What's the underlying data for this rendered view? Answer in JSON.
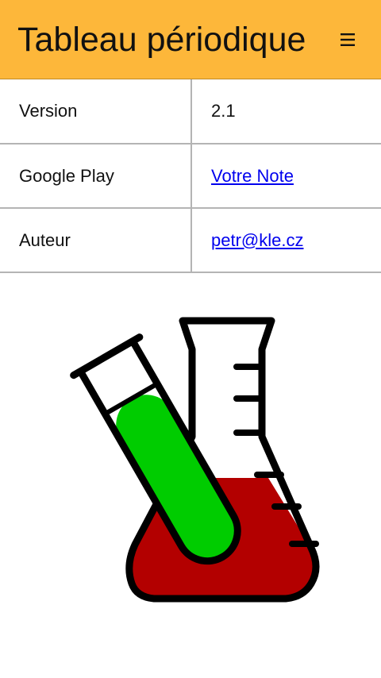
{
  "header": {
    "title": "Tableau périodique",
    "menu_icon": "hamburger-menu-icon",
    "background_color": "#fdb73a"
  },
  "info": {
    "rows": [
      {
        "label": "Version",
        "value": "2.1",
        "is_link": false
      },
      {
        "label": "Google Play",
        "value": "Votre Note",
        "is_link": true
      },
      {
        "label": "Auteur",
        "value": "petr@kle.cz",
        "is_link": true
      }
    ]
  },
  "illustration": {
    "icon": "chemistry-flask-and-test-tube-icon",
    "liquid_colors": {
      "flask": "#b30000",
      "tube": "#00cc00"
    }
  }
}
